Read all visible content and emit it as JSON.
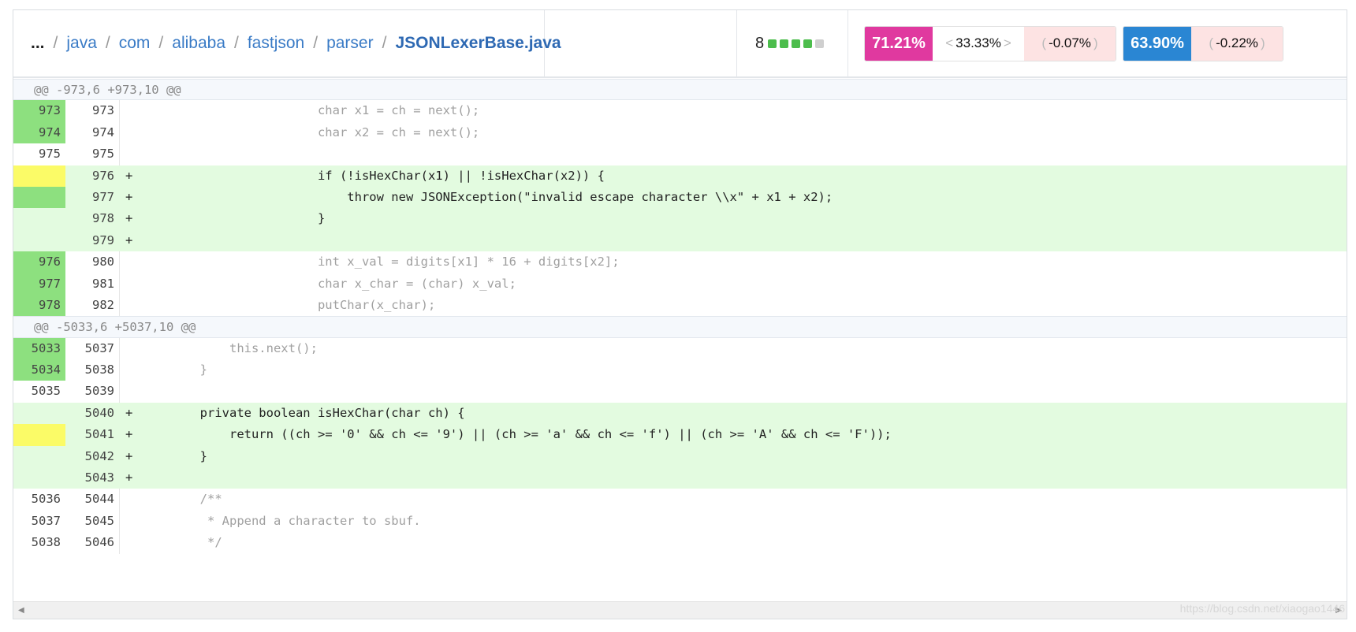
{
  "breadcrumb": {
    "ellipsis": "...",
    "parts": [
      "java",
      "com",
      "alibaba",
      "fastjson",
      "parser"
    ],
    "file": "JSONLexerBase.java",
    "separator": "/"
  },
  "grade": {
    "number": "8",
    "squares": [
      "#4cbd4c",
      "#4cbd4c",
      "#4cbd4c",
      "#4cbd4c",
      "#cfcfcf"
    ]
  },
  "metrics": [
    {
      "main": "71.21%",
      "main_color": "#e0399f",
      "subs": [
        {
          "value": "33.33%",
          "open": "<",
          "close": ">",
          "bg": "#ffffff"
        },
        {
          "value": "-0.07%",
          "open": "(",
          "close": ")",
          "bg": "#fde3e3"
        }
      ]
    },
    {
      "main": "63.90%",
      "main_color": "#2a86d3",
      "subs": [
        {
          "value": "-0.22%",
          "open": "(",
          "close": ")",
          "bg": "#fde3e3"
        }
      ]
    }
  ],
  "hunks": [
    {
      "header": "@@ -973,6 +973,10 @@",
      "lines": [
        {
          "old": "973",
          "new": "973",
          "mark": "",
          "code": "                        char x1 = ch = next();",
          "cov": "full",
          "added": false
        },
        {
          "old": "974",
          "new": "974",
          "mark": "",
          "code": "                        char x2 = ch = next();",
          "cov": "full",
          "added": false
        },
        {
          "old": "975",
          "new": "975",
          "mark": "",
          "code": "",
          "cov": "",
          "added": false
        },
        {
          "old": "",
          "new": "976",
          "mark": "+",
          "code": "                        if (!isHexChar(x1) || !isHexChar(x2)) {",
          "cov": "part",
          "added": true
        },
        {
          "old": "",
          "new": "977",
          "mark": "+",
          "code": "                            throw new JSONException(\"invalid escape character \\\\x\" + x1 + x2);",
          "cov": "full",
          "added": true
        },
        {
          "old": "",
          "new": "978",
          "mark": "+",
          "code": "                        }",
          "cov": "",
          "added": true
        },
        {
          "old": "",
          "new": "979",
          "mark": "+",
          "code": "",
          "cov": "",
          "added": true
        },
        {
          "old": "976",
          "new": "980",
          "mark": "",
          "code": "                        int x_val = digits[x1] * 16 + digits[x2];",
          "cov": "full",
          "added": false
        },
        {
          "old": "977",
          "new": "981",
          "mark": "",
          "code": "                        char x_char = (char) x_val;",
          "cov": "full",
          "added": false
        },
        {
          "old": "978",
          "new": "982",
          "mark": "",
          "code": "                        putChar(x_char);",
          "cov": "full",
          "added": false
        }
      ]
    },
    {
      "header": "@@ -5033,6 +5037,10 @@",
      "lines": [
        {
          "old": "5033",
          "new": "5037",
          "mark": "",
          "code": "            this.next();",
          "cov": "full",
          "added": false
        },
        {
          "old": "5034",
          "new": "5038",
          "mark": "",
          "code": "        }",
          "cov": "full",
          "added": false
        },
        {
          "old": "5035",
          "new": "5039",
          "mark": "",
          "code": "",
          "cov": "",
          "added": false
        },
        {
          "old": "",
          "new": "5040",
          "mark": "+",
          "code": "        private boolean isHexChar(char ch) {",
          "cov": "",
          "added": true
        },
        {
          "old": "",
          "new": "5041",
          "mark": "+",
          "code": "            return ((ch >= '0' && ch <= '9') || (ch >= 'a' && ch <= 'f') || (ch >= 'A' && ch <= 'F'));",
          "cov": "part",
          "added": true
        },
        {
          "old": "",
          "new": "5042",
          "mark": "+",
          "code": "        }",
          "cov": "",
          "added": true
        },
        {
          "old": "",
          "new": "5043",
          "mark": "+",
          "code": "",
          "cov": "",
          "added": true
        },
        {
          "old": "5036",
          "new": "5044",
          "mark": "",
          "code": "        /**",
          "cov": "",
          "added": false
        },
        {
          "old": "5037",
          "new": "5045",
          "mark": "",
          "code": "         * Append a character to sbuf.",
          "cov": "",
          "added": false
        },
        {
          "old": "5038",
          "new": "5046",
          "mark": "",
          "code": "         */",
          "cov": "",
          "added": false
        }
      ]
    }
  ],
  "scrollbar": {
    "left_arrow": "◀",
    "right_arrow": "▶"
  },
  "watermark": "https://blog.csdn.net/xiaogao1446"
}
